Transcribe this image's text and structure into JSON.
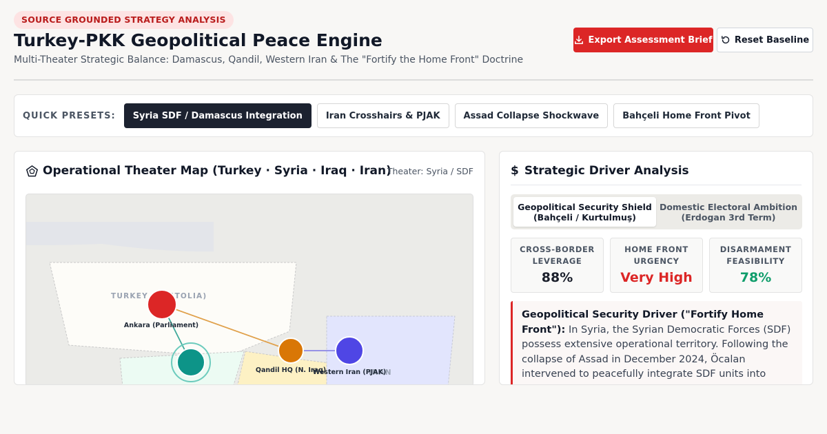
{
  "header": {
    "badge": "SOURCE GROUNDED STRATEGY ANALYSIS",
    "title": "Turkey-PKK Geopolitical Peace Engine",
    "subtitle": "Multi-Theater Strategic Balance: Damascus, Qandil, Western Iran & The \"Fortify the Home Front\" Doctrine",
    "export_label": "Export Assessment Brief",
    "reset_label": "Reset Baseline",
    "export_icon": "download-icon",
    "reset_icon": "reset-icon"
  },
  "presets": {
    "label": "QUICK PRESETS:",
    "items": [
      {
        "label": "Syria SDF / Damascus Integration",
        "active": true
      },
      {
        "label": "Iran Crosshairs & PJAK",
        "active": false
      },
      {
        "label": "Assad Collapse Shockwave",
        "active": false
      },
      {
        "label": "Bahçeli Home Front Pivot",
        "active": false
      }
    ]
  },
  "map": {
    "title": "Operational Theater Map (Turkey · Syria · Iraq · Iran)",
    "title_icon": "pentagon-icon",
    "theater": "Theater: Syria / SDF",
    "regions": {
      "turkey": "TURKEY (ANATOLIA)",
      "iran": "IRAN"
    },
    "nodes": {
      "ankara": {
        "label": "Ankara (Parliament)",
        "color": "#dc2626"
      },
      "qandil": {
        "label": "Qandil HQ (N. Iraq)",
        "color": "#d97706"
      },
      "western_iran": {
        "label": "Western Iran (PJAK)",
        "color": "#4f46e5"
      },
      "syria": {
        "color": "#0d9488"
      }
    }
  },
  "drivers": {
    "title": "Strategic Driver Analysis",
    "title_icon": "dollar-icon",
    "toggle": {
      "option_a_line1": "Geopolitical Security Shield",
      "option_a_line2": "(Bahçeli / Kurtulmuş)",
      "option_b_line1": "Domestic Electoral Ambition",
      "option_b_line2": "(Erdogan 3rd Term)"
    },
    "metrics": [
      {
        "label_line1": "CROSS-BORDER",
        "label_line2": "LEVERAGE",
        "value": "88%",
        "color": "#1a1f2b"
      },
      {
        "label_line1": "HOME FRONT",
        "label_line2": "URGENCY",
        "value": "Very High",
        "color": "#dc2626"
      },
      {
        "label_line1": "DISARMAMENT",
        "label_line2": "FEASIBILITY",
        "value": "78%",
        "color": "#0f9d6b"
      }
    ],
    "callout": {
      "heading": "Geopolitical Security Driver (\"Fortify Home Front\"):",
      "body": "In Syria, the Syrian Democratic Forces (SDF) possess extensive operational territory. Following the collapse of Assad in December 2024, Öcalan intervened to peacefully integrate SDF units into Damascus"
    }
  },
  "colors": {
    "accent_red": "#dc2626",
    "dark": "#1c2230"
  }
}
